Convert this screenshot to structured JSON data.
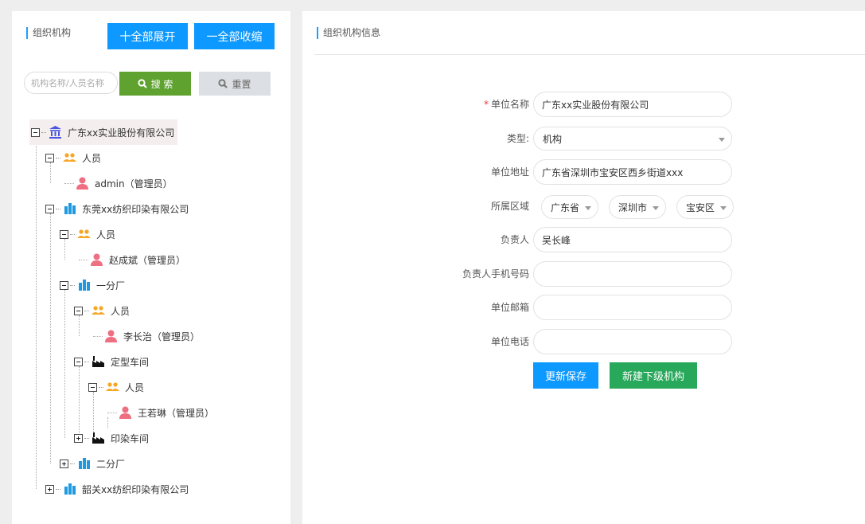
{
  "left": {
    "title": "组织机构",
    "expand_all": "十全部展开",
    "collapse_all": "一全部收缩",
    "search_placeholder": "机构名称/人员名称",
    "search_label": "搜 索",
    "reset_label": "重置"
  },
  "tree": {
    "root": "广东xx实业股份有限公司",
    "n_people1": "人员",
    "n_admin": "admin（管理员）",
    "n_dongguan": "东莞xx纺织印染有限公司",
    "n_people2": "人员",
    "n_zhao": "赵成斌（管理员）",
    "n_factory1": "一分厂",
    "n_people3": "人员",
    "n_li": "李长治（管理员）",
    "n_dingxing": "定型车间",
    "n_people4": "人员",
    "n_wang": "王若琳（管理员）",
    "n_yinran": "印染车间",
    "n_factory2": "二分厂",
    "n_shaoguan": "韶关xx纺织印染有限公司"
  },
  "right": {
    "title": "组织机构信息",
    "form": {
      "name_label": "单位名称",
      "name_value": "广东xx实业股份有限公司",
      "type_label": "类型:",
      "type_value": "机构",
      "address_label": "单位地址",
      "address_value": "广东省深圳市宝安区西乡街道xxx",
      "region_label": "所属区域",
      "province": "广东省",
      "city": "深圳市",
      "district": "宝安区",
      "leader_label": "负责人",
      "leader_value": "吴长峰",
      "phone_label": "负责人手机号码",
      "phone_value": "",
      "email_label": "单位邮箱",
      "email_value": "",
      "tel_label": "单位电话",
      "tel_value": ""
    },
    "update_button": "更新保存",
    "new_sub_button": "新建下级机构"
  },
  "colors": {
    "primary_blue": "#0d99ff",
    "search_green": "#5fa22f",
    "new_green": "#28a85a",
    "person_pink": "#ef6f82",
    "group_orange": "#f5a623",
    "building_blue": "#1f9ae0"
  }
}
